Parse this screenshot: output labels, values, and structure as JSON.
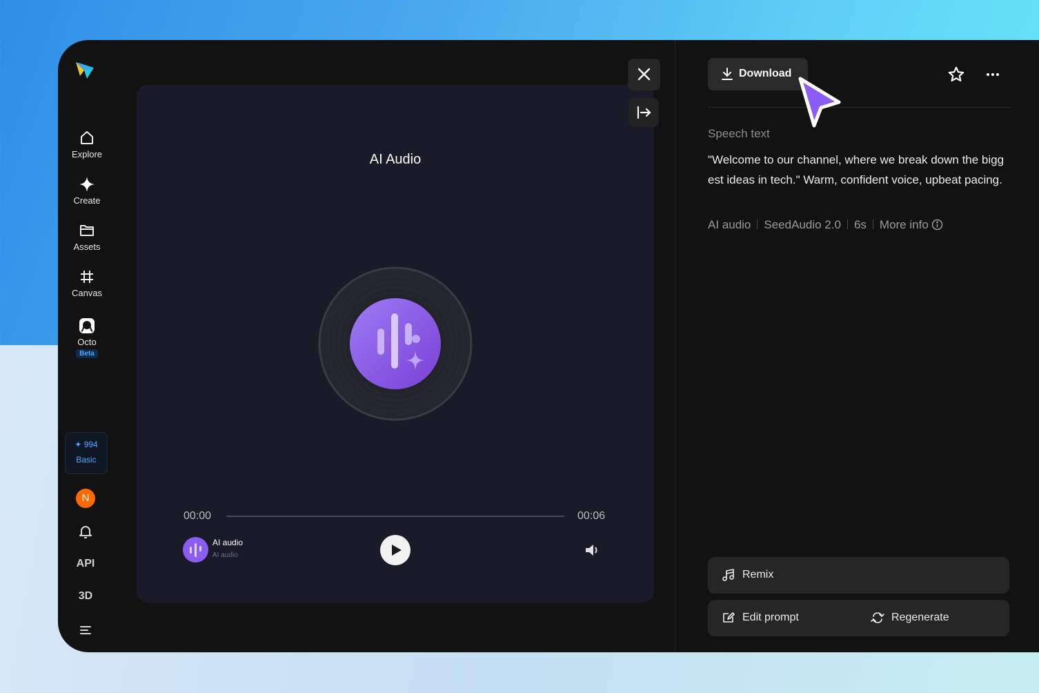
{
  "sidebar": {
    "items": [
      {
        "label": "Explore"
      },
      {
        "label": "Create"
      },
      {
        "label": "Assets"
      },
      {
        "label": "Canvas"
      },
      {
        "label": "Octo",
        "badge": "Beta"
      }
    ],
    "credits": {
      "amount": "994",
      "plan": "Basic"
    },
    "avatar_initial": "N",
    "api_label": "API",
    "three_d_label": "3D"
  },
  "preview": {
    "title": "AI Audio",
    "time_current": "00:00",
    "time_total": "00:06",
    "progress": 0,
    "track_title": "AI audio",
    "track_subtitle": "AI audio"
  },
  "details": {
    "download_label": "Download",
    "speech_label": "Speech text",
    "speech_text": "\"Welcome to our channel, where we break down the biggest ideas in tech.\" Warm, confident voice, upbeat pacing.",
    "meta": {
      "type": "AI audio",
      "model": "SeedAudio 2.0",
      "duration": "6s",
      "more_info": "More info"
    },
    "actions": {
      "remix": "Remix",
      "edit_prompt": "Edit prompt",
      "regenerate": "Regenerate"
    }
  },
  "colors": {
    "accent": "#49a6ff",
    "avatar": "#ff6a00",
    "disc_purple": "#8a5cf0",
    "cursor": "#8b5cf6"
  }
}
